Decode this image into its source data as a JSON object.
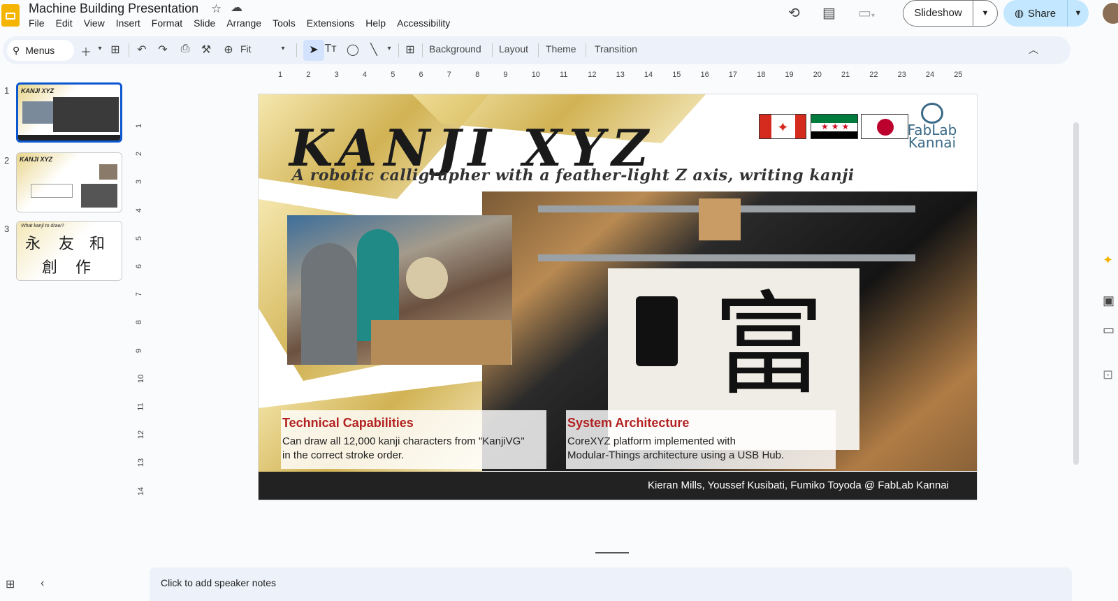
{
  "header": {
    "title": "Machine Building Presentation",
    "menu": [
      "File",
      "Edit",
      "View",
      "Insert",
      "Format",
      "Slide",
      "Arrange",
      "Tools",
      "Extensions",
      "Help",
      "Accessibility"
    ],
    "slideshow_label": "Slideshow",
    "share_label": "Share"
  },
  "toolbar": {
    "search_label": "Menus",
    "zoom_label": "Fit",
    "background_label": "Background",
    "layout_label": "Layout",
    "theme_label": "Theme",
    "transition_label": "Transition"
  },
  "filmstrip": {
    "slides": [
      {
        "number": "1",
        "title": "KANJI XYZ"
      },
      {
        "number": "2",
        "title": "KANJI XYZ"
      },
      {
        "number": "3",
        "title": "What kanji to draw?",
        "glyphs": [
          "永",
          "友",
          "和",
          "創",
          "作"
        ]
      }
    ]
  },
  "ruler": {
    "h_ticks": [
      "1",
      "2",
      "3",
      "4",
      "5",
      "6",
      "7",
      "8",
      "9",
      "10",
      "11",
      "12",
      "13",
      "14",
      "15",
      "16",
      "17",
      "18",
      "19",
      "20",
      "21",
      "22",
      "23",
      "24",
      "25"
    ],
    "v_ticks": [
      "1",
      "2",
      "3",
      "4",
      "5",
      "6",
      "7",
      "8",
      "9",
      "10",
      "11",
      "12",
      "13",
      "14"
    ]
  },
  "slide": {
    "title": "KANJI XYZ",
    "subtitle": "A robotic calligrapher with a feather-light Z axis, writing kanji",
    "logo_line1": "FabLab",
    "logo_line2": "Kannai",
    "photo_kanji": "富",
    "tech_title": "Technical Capabilities",
    "tech_text_1": "Can draw all 12,000 kanji characters from \"KanjiVG\"",
    "tech_text_2": "in the correct stroke order.",
    "arch_title": "System Architecture",
    "arch_text_1": "CoreXYZ platform implemented with",
    "arch_text_2": "Modular-Things architecture using a USB Hub.",
    "footer": "Kieran Mills, Youssef Kusibati, Fumiko Toyoda @ FabLab Kannai"
  },
  "notes": {
    "placeholder": "Click to add speaker notes"
  },
  "colors": {
    "accent": "#0b57d0",
    "share_bg": "#c2e7ff",
    "heading_red": "#b22222",
    "slides_yellow": "#f4b400"
  }
}
